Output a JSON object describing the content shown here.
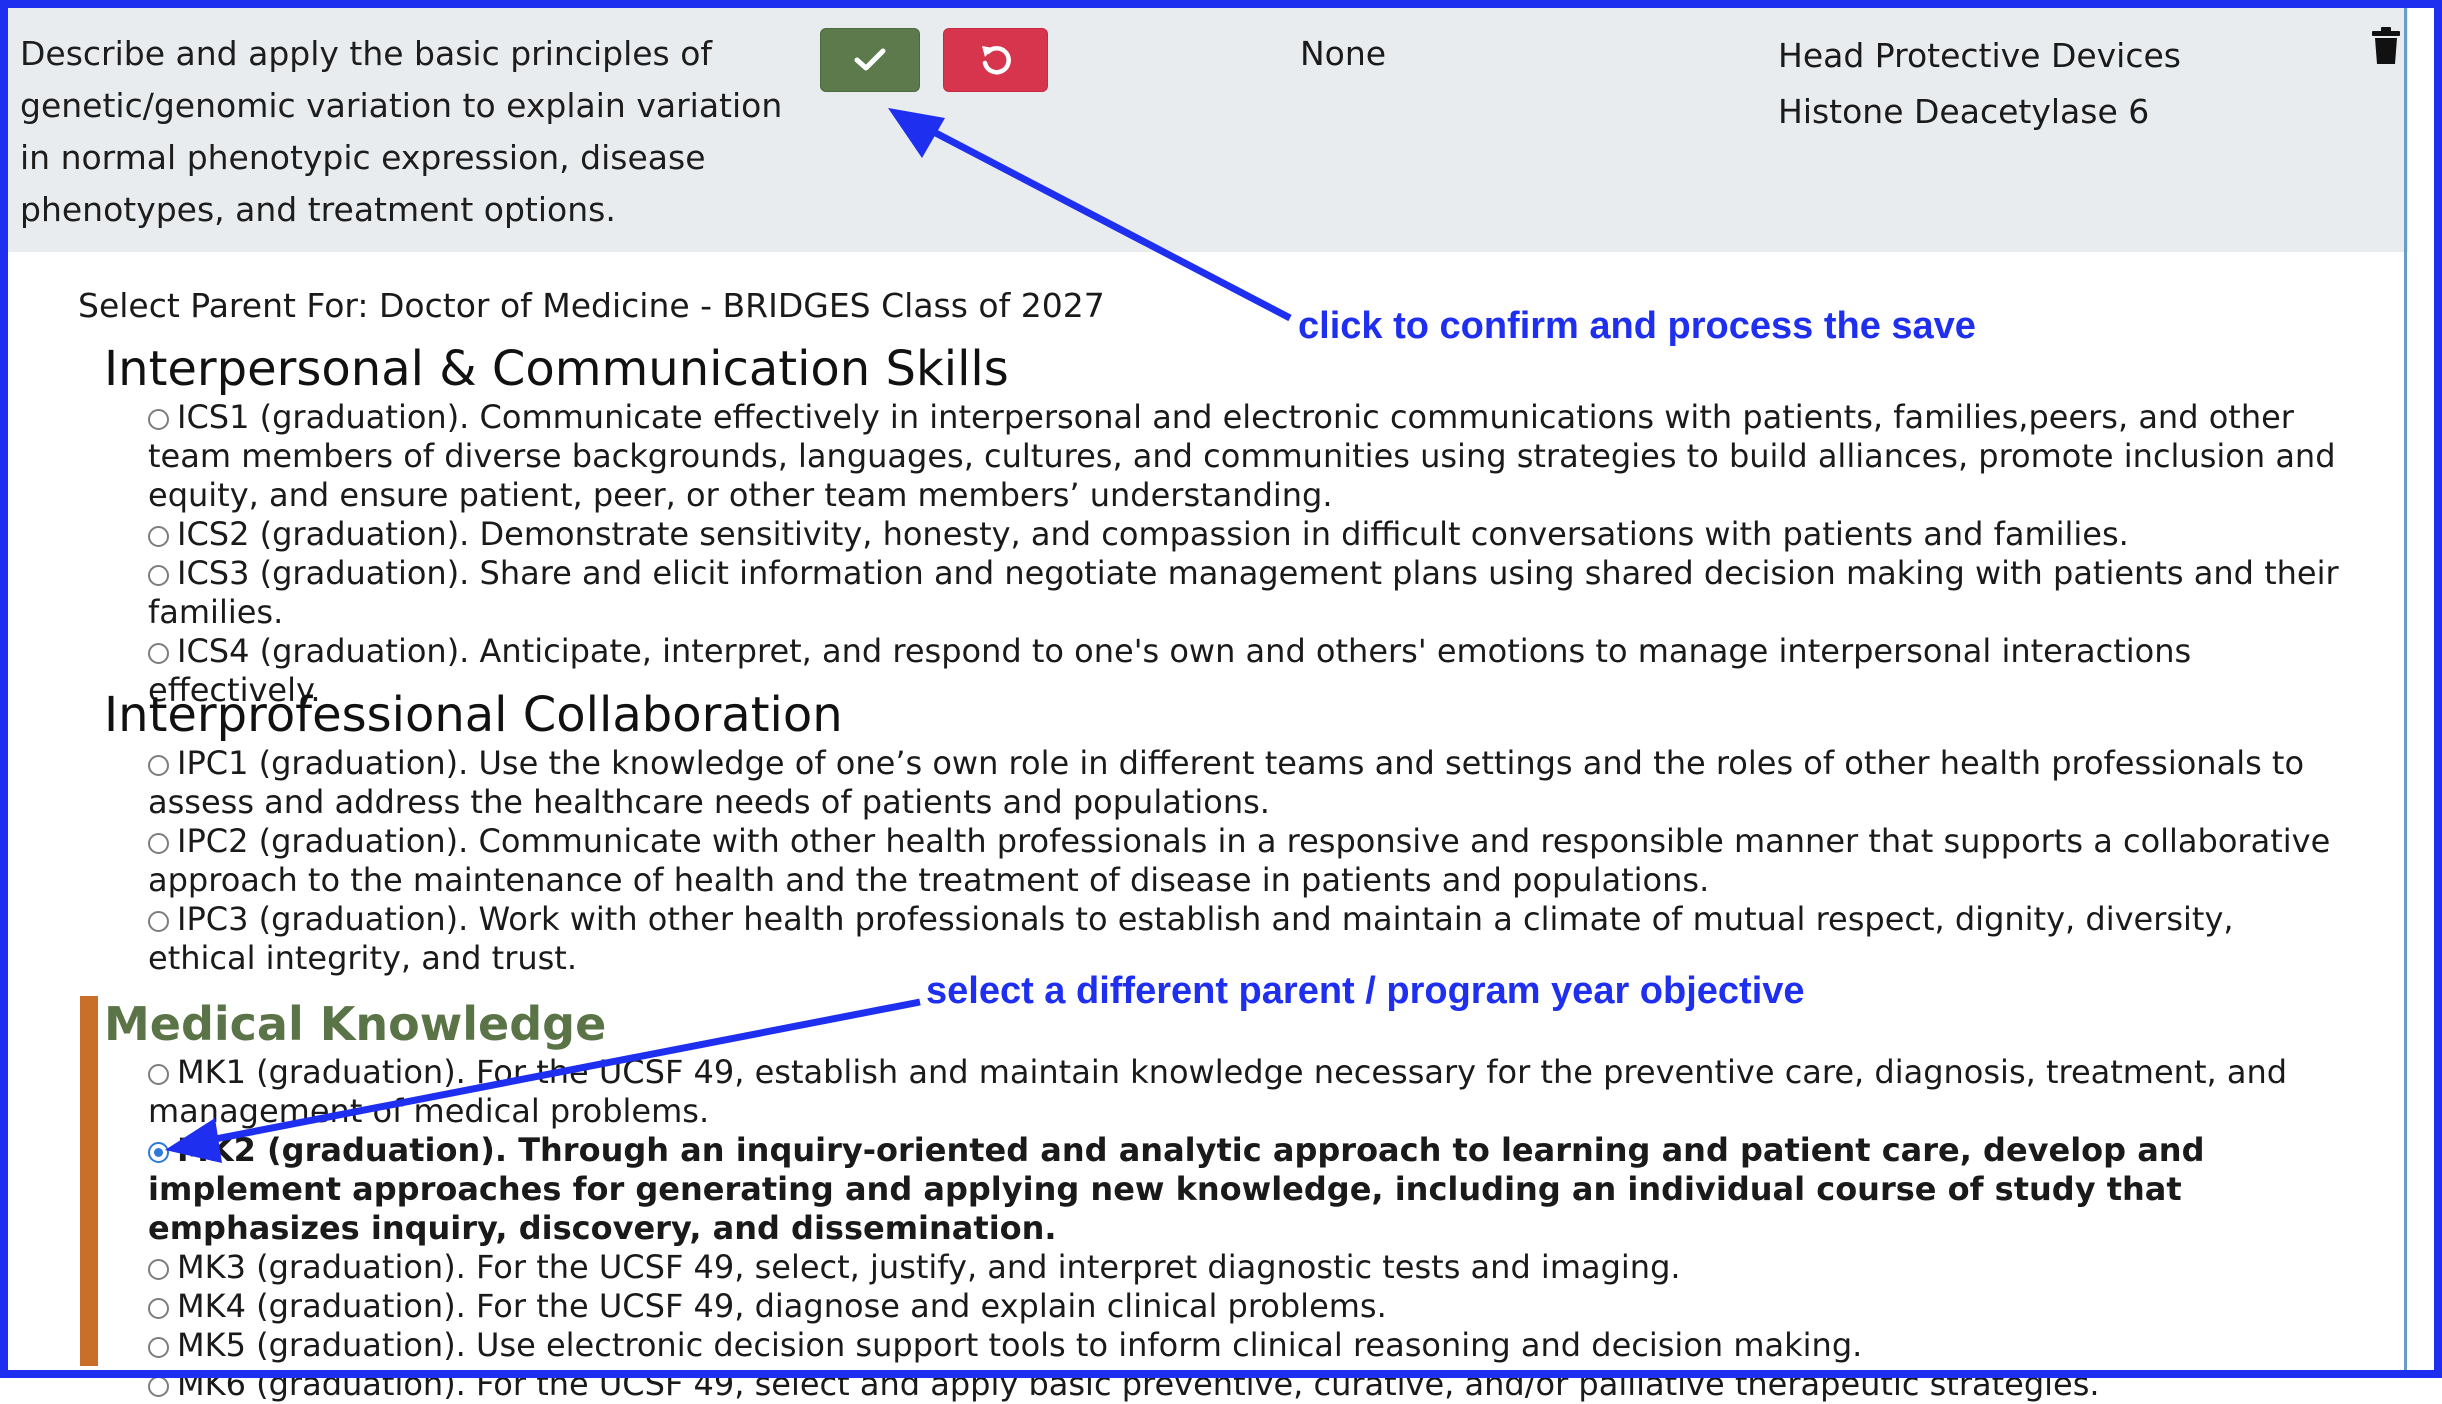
{
  "row": {
    "objective_text": "Describe and apply the basic principles of genetic/genomic variation to explain variation in normal phenotypic expression, disease phenotypes, and treatment options.",
    "parent_value": "None",
    "terms": [
      "Head Protective Devices",
      "Histone Deacetylase 6"
    ],
    "confirm_icon": "check-icon",
    "undo_icon": "undo-icon",
    "delete_icon": "trash-icon",
    "colors": {
      "confirm": "#5c7a4c",
      "undo": "#d7354e",
      "highlight": "#c86f2a",
      "annotation": "#1f2ff0"
    }
  },
  "selector": {
    "heading": "Select Parent For: Doctor of Medicine - BRIDGES Class of 2027",
    "groups": [
      {
        "title": "Interpersonal & Communication Skills",
        "items": [
          "ICS1 (graduation). Communicate effectively in interpersonal and electronic communications with patients, families,peers, and other team members of diverse backgrounds, languages, cultures, and communities using strategies to build alliances, promote inclusion and equity, and ensure patient, peer, or other team members’ understanding.",
          "ICS2 (graduation). Demonstrate sensitivity, honesty, and compassion in difficult conversations with patients and families.",
          "ICS3 (graduation). Share and elicit information and negotiate management plans using shared decision making with patients and their families.",
          "ICS4 (graduation). Anticipate, interpret, and respond to one's own and others' emotions to manage interpersonal interactions effectively."
        ]
      },
      {
        "title": "Interprofessional Collaboration",
        "items": [
          "IPC1 (graduation). Use the knowledge of one’s own role in different teams and settings and the roles of other health professionals to assess and address the healthcare needs of patients and populations.",
          "IPC2 (graduation). Communicate with other health professionals in a responsive and responsible manner that supports a collaborative approach to the maintenance of health and the treatment of disease in patients and populations.",
          "IPC3 (graduation). Work with other health professionals to establish and maintain a climate of mutual respect, dignity, diversity, ethical integrity, and trust."
        ]
      },
      {
        "title": "Medical Knowledge",
        "items": [
          "MK1 (graduation). For the UCSF 49, establish and maintain knowledge necessary for the preventive care, diagnosis, treatment, and management of medical problems.",
          "MK2 (graduation). Through an inquiry-oriented and analytic approach to learning and patient care, develop and implement approaches for generating and applying new knowledge, including an individual course of study that emphasizes inquiry, discovery, and dissemination.",
          "MK3 (graduation). For the UCSF 49, select, justify, and interpret diagnostic tests and imaging.",
          "MK4 (graduation). For the UCSF 49, diagnose and explain clinical problems.",
          "MK5 (graduation). Use electronic decision support tools to inform clinical reasoning and decision making.",
          "MK6 (graduation). For the UCSF 49, select and apply basic preventive, curative, and/or palliative therapeutic strategies."
        ]
      }
    ]
  },
  "annotations": {
    "confirm": "click to confirm and process the save",
    "select": "select a different parent / program year objective"
  }
}
